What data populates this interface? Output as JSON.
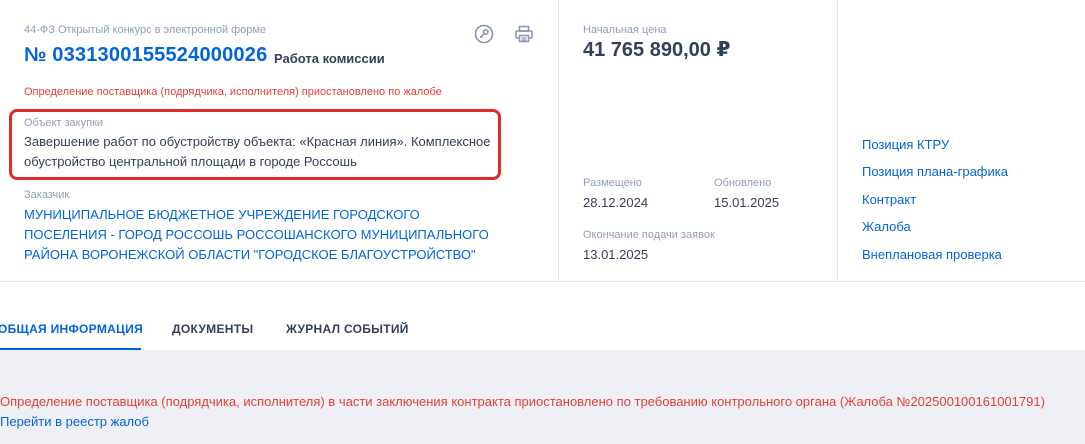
{
  "header": {
    "law_type": "44-ФЗ Открытый конкурс в электронной форме",
    "reg_number": "№ 0331300155524000026",
    "stage": "Работа комиссии",
    "suspended_note": "Определение поставщика (подрядчика, исполнителя) приостановлено по жалобе"
  },
  "object": {
    "label": "Объект закупки",
    "text": "Завершение работ по обустройству объекта: «Красная линия». Комплексное обустройство центральной площади в городе Россошь"
  },
  "customer": {
    "label": "Заказчик",
    "name": "МУНИЦИПАЛЬНОЕ БЮДЖЕТНОЕ УЧРЕЖДЕНИЕ ГОРОДСКОГО ПОСЕЛЕНИЯ - ГОРОД РОССОШЬ РОССОШАНСКОГО МУНИЦИПАЛЬНОГО РАЙОНА ВОРОНЕЖСКОЙ ОБЛАСТИ \"ГОРОДСКОЕ БЛАГОУСТРОЙСТВО\""
  },
  "price": {
    "label": "Начальная цена",
    "value": "41 765 890,00 ₽"
  },
  "dates": {
    "posted_label": "Размещено",
    "posted_value": "28.12.2024",
    "updated_label": "Обновлено",
    "updated_value": "15.01.2025",
    "deadline_label": "Окончание подачи заявок",
    "deadline_value": "13.01.2025"
  },
  "side_links": [
    {
      "label": "Позиция КТРУ"
    },
    {
      "label": "Позиция плана-графика"
    },
    {
      "label": "Контракт"
    },
    {
      "label": "Жалоба"
    },
    {
      "label": "Внеплановая проверка"
    }
  ],
  "tabs": [
    {
      "label": "ОБЩАЯ ИНФОРМАЦИЯ",
      "active": true
    },
    {
      "label": "ДОКУМЕНТЫ",
      "active": false
    },
    {
      "label": "ЖУРНАЛ СОБЫТИЙ",
      "active": false
    }
  ],
  "notice": {
    "text": "Определение поставщика (подрядчика, исполнителя) в части заключения контракта приостановлено по требованию контрольного органа (Жалоба №202500100161001791)",
    "link": "Перейти в реестр жалоб"
  },
  "icons": {
    "favorite": "key-circle-icon",
    "print": "printer-icon"
  },
  "colors": {
    "link": "#0065dd",
    "alert": "#e53f37",
    "highlight_border": "#e02b2b",
    "muted": "#909ebb",
    "text": "#334059"
  }
}
